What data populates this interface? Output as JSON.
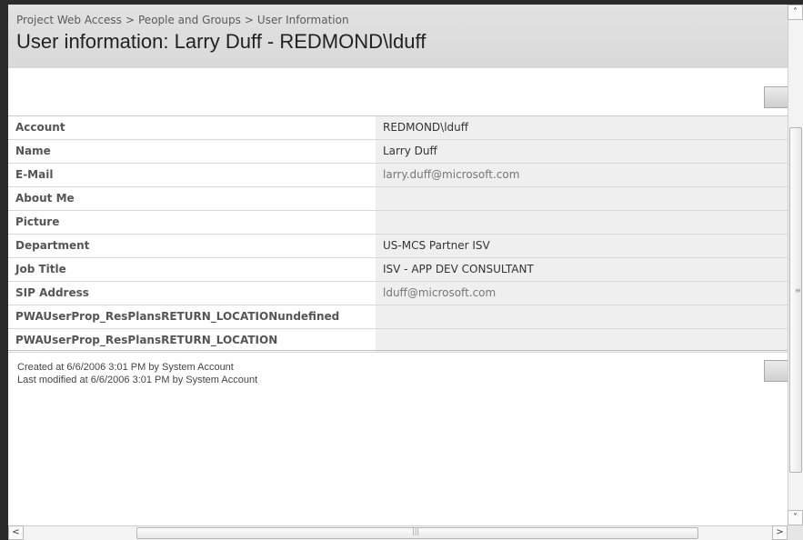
{
  "breadcrumb": {
    "items": [
      "Project Web Access",
      "People and Groups",
      "User Information"
    ],
    "separator": ">"
  },
  "page": {
    "title": "User information: Larry Duff - REDMOND\\lduff"
  },
  "user_info": {
    "rows": [
      {
        "label": "Account",
        "value": "REDMOND\\lduff"
      },
      {
        "label": "Name",
        "value": "Larry Duff"
      },
      {
        "label": "E-Mail",
        "value": "larry.duff@microsoft.com"
      },
      {
        "label": "About Me",
        "value": ""
      },
      {
        "label": "Picture",
        "value": ""
      },
      {
        "label": "Department",
        "value": "US-MCS Partner ISV"
      },
      {
        "label": "Job Title",
        "value": "ISV - APP DEV CONSULTANT"
      },
      {
        "label": "SIP Address",
        "value": "lduff@microsoft.com"
      },
      {
        "label": "PWAUserProp_ResPlansRETURN_LOCATIONundefined",
        "value": ""
      },
      {
        "label": "PWAUserProp_ResPlansRETURN_LOCATION",
        "value": ""
      }
    ]
  },
  "footer": {
    "created": "Created at 6/6/2006 3:01 PM  by System Account",
    "modified": "Last modified at 6/6/2006 3:01 PM  by System Account"
  },
  "scrollbars": {
    "up_arrow": "˄",
    "down_arrow": "˅",
    "left_arrow": "<",
    "right_arrow": ">",
    "grip": "|||",
    "vgrip": "≡"
  }
}
